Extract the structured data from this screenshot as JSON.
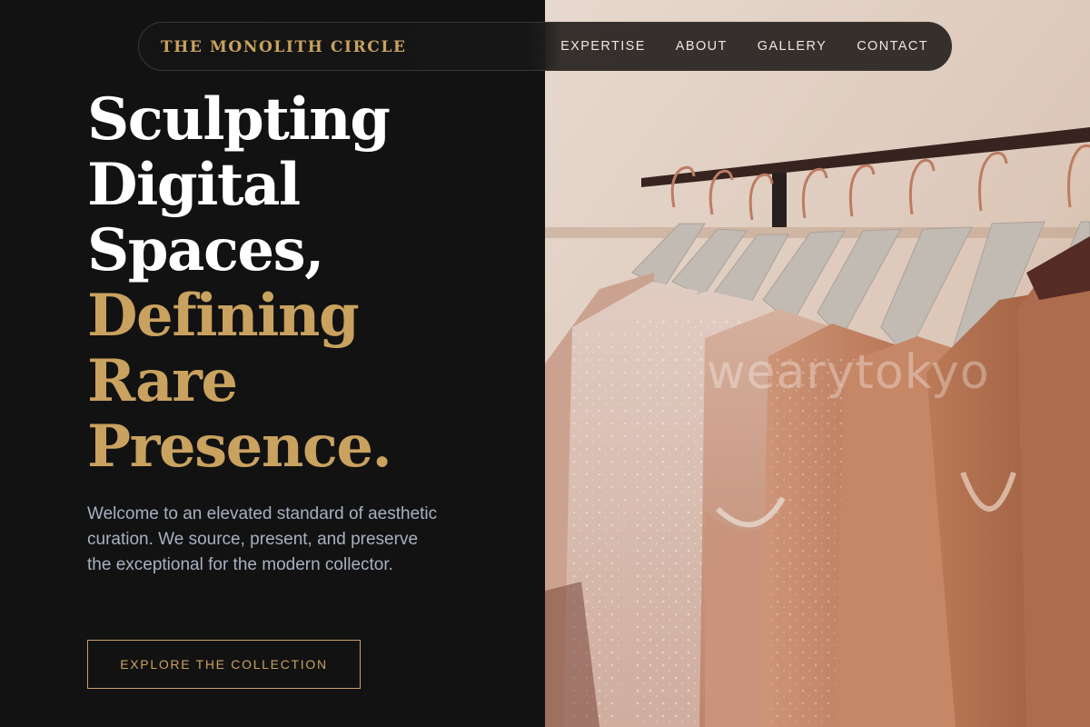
{
  "brand": {
    "name": "THE MONOLITH CIRCLE"
  },
  "nav": {
    "items": [
      {
        "label": "EXPERTISE"
      },
      {
        "label": "ABOUT"
      },
      {
        "label": "GALLERY"
      },
      {
        "label": "CONTACT"
      }
    ]
  },
  "hero": {
    "headline_lines": [
      "Sculpting",
      "Digital",
      "Spaces,",
      "Defining",
      "Rare",
      "Presence."
    ],
    "lede": "Welcome to an elevated standard of aesthetic curation. We source, present, and preserve the exceptional for the modern collector.",
    "cta_label": "EXPLORE THE COLLECTION"
  },
  "image": {
    "watermark": "wearytokyo"
  },
  "colors": {
    "background": "#121212",
    "accent": "#c9a25f",
    "headline": "#ffffff",
    "body_text": "#a7b1c1",
    "nav_text": "#ece7df"
  }
}
